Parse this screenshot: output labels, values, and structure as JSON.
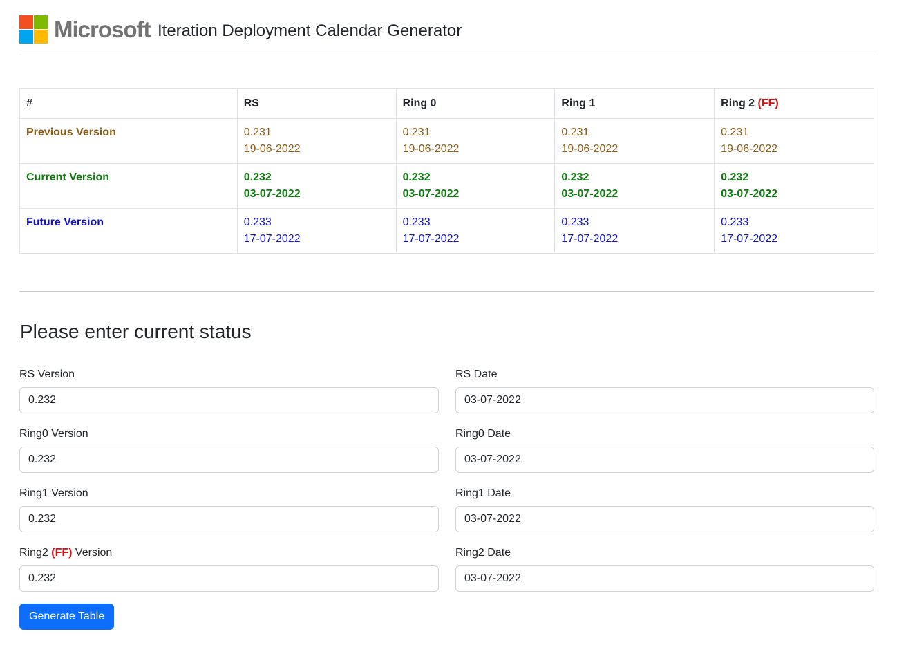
{
  "header": {
    "brand": "Microsoft",
    "title": "Iteration Deployment Calendar Generator"
  },
  "table": {
    "headers": [
      "#",
      "RS",
      "Ring 0",
      "Ring 1",
      "Ring 2"
    ],
    "ff_tag": "(FF)",
    "rows": [
      {
        "label": "Previous Version",
        "cells": [
          {
            "version": "0.231",
            "date": "19-06-2022"
          },
          {
            "version": "0.231",
            "date": "19-06-2022"
          },
          {
            "version": "0.231",
            "date": "19-06-2022"
          },
          {
            "version": "0.231",
            "date": "19-06-2022"
          }
        ]
      },
      {
        "label": "Current Version",
        "cells": [
          {
            "version": "0.232",
            "date": "03-07-2022"
          },
          {
            "version": "0.232",
            "date": "03-07-2022"
          },
          {
            "version": "0.232",
            "date": "03-07-2022"
          },
          {
            "version": "0.232",
            "date": "03-07-2022"
          }
        ]
      },
      {
        "label": "Future Version",
        "cells": [
          {
            "version": "0.233",
            "date": "17-07-2022"
          },
          {
            "version": "0.233",
            "date": "17-07-2022"
          },
          {
            "version": "0.233",
            "date": "17-07-2022"
          },
          {
            "version": "0.233",
            "date": "17-07-2022"
          }
        ]
      }
    ]
  },
  "form": {
    "title": "Please enter current status",
    "fields": [
      {
        "label": "RS Version",
        "value": "0.232"
      },
      {
        "label": "RS Date",
        "value": "03-07-2022"
      },
      {
        "label": "Ring0 Version",
        "value": "0.232"
      },
      {
        "label": "Ring0 Date",
        "value": "03-07-2022"
      },
      {
        "label": "Ring1 Version",
        "value": "0.232"
      },
      {
        "label": "Ring1 Date",
        "value": "03-07-2022"
      },
      {
        "label_prefix": "Ring2",
        "label_tag": "(FF)",
        "label_suffix": "Version",
        "value": "0.232"
      },
      {
        "label": "Ring2 Date",
        "value": "03-07-2022"
      }
    ],
    "submit_label": "Generate Table"
  },
  "colors": {
    "previous": "#8b5a13",
    "current": "#0d7c0d",
    "future": "#1212c0",
    "ff": "#dc1010",
    "primary": "#0d6efd"
  }
}
